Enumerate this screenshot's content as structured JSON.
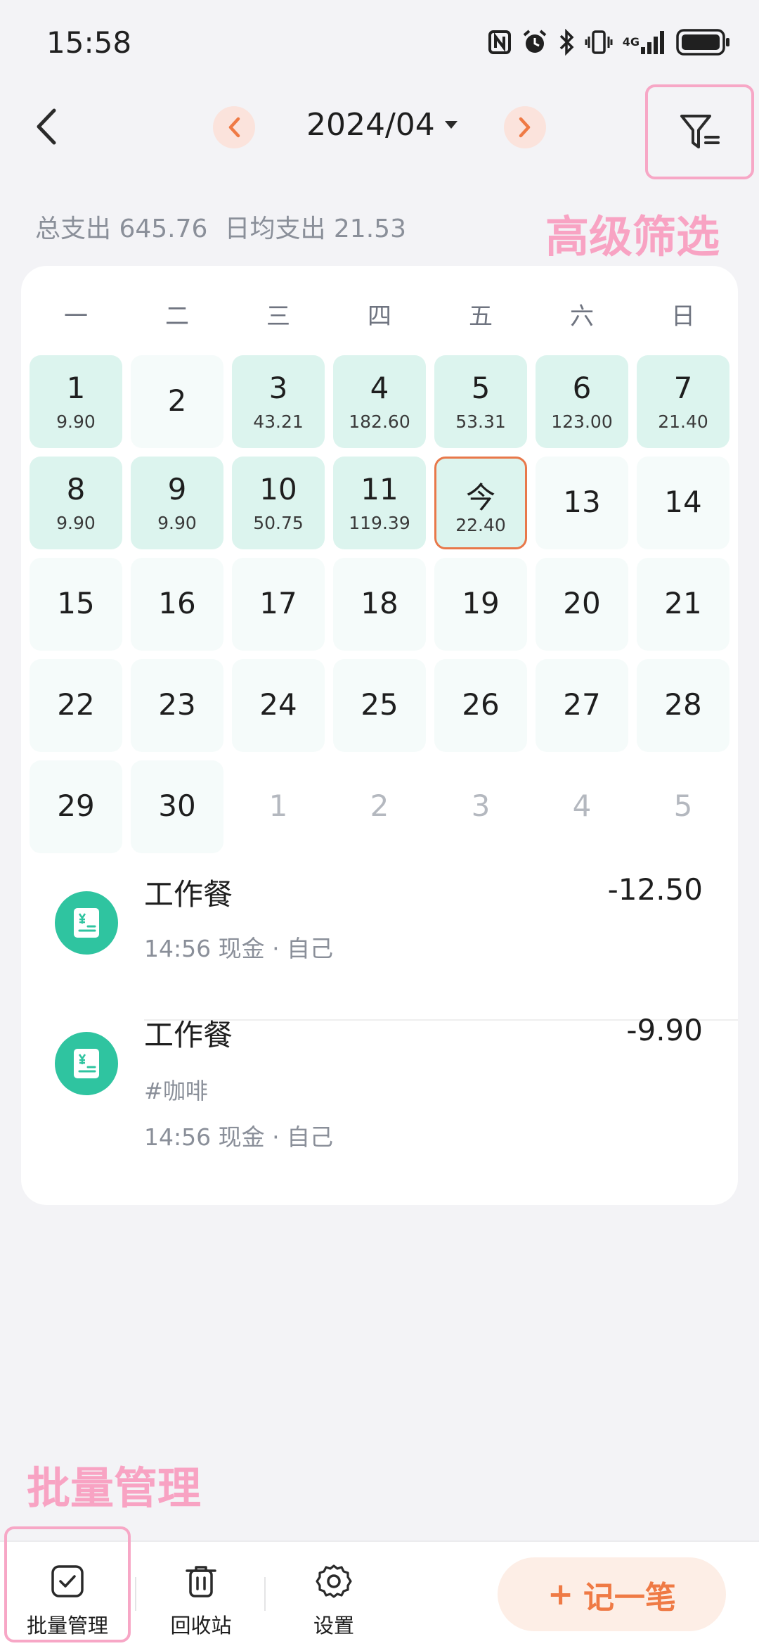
{
  "status_bar": {
    "time": "15:58",
    "network": "4G",
    "icons": [
      "nfc-icon",
      "alarm-icon",
      "bluetooth-icon",
      "vibrate-icon",
      "signal-icon",
      "battery-icon"
    ]
  },
  "header": {
    "month": "2024/04",
    "icons": [
      "back-icon",
      "prev-month-icon",
      "next-month-icon",
      "filter-icon"
    ]
  },
  "summary": {
    "total_label": "总支出",
    "total_value": "645.76",
    "avg_label": "日均支出",
    "avg_value": "21.53"
  },
  "annotations": {
    "filter": "高级筛选",
    "batch": "批量管理"
  },
  "calendar": {
    "weekdays": [
      "一",
      "二",
      "三",
      "四",
      "五",
      "六",
      "日"
    ],
    "days": [
      {
        "label": "1",
        "amount": "9.90",
        "state": "spent"
      },
      {
        "label": "2",
        "amount": "",
        "state": "empty"
      },
      {
        "label": "3",
        "amount": "43.21",
        "state": "spent"
      },
      {
        "label": "4",
        "amount": "182.60",
        "state": "spent"
      },
      {
        "label": "5",
        "amount": "53.31",
        "state": "spent"
      },
      {
        "label": "6",
        "amount": "123.00",
        "state": "spent"
      },
      {
        "label": "7",
        "amount": "21.40",
        "state": "spent"
      },
      {
        "label": "8",
        "amount": "9.90",
        "state": "spent"
      },
      {
        "label": "9",
        "amount": "9.90",
        "state": "spent"
      },
      {
        "label": "10",
        "amount": "50.75",
        "state": "spent"
      },
      {
        "label": "11",
        "amount": "119.39",
        "state": "spent"
      },
      {
        "label": "今",
        "amount": "22.40",
        "state": "today"
      },
      {
        "label": "13",
        "amount": "",
        "state": "empty"
      },
      {
        "label": "14",
        "amount": "",
        "state": "empty"
      },
      {
        "label": "15",
        "amount": "",
        "state": "empty"
      },
      {
        "label": "16",
        "amount": "",
        "state": "empty"
      },
      {
        "label": "17",
        "amount": "",
        "state": "empty"
      },
      {
        "label": "18",
        "amount": "",
        "state": "empty"
      },
      {
        "label": "19",
        "amount": "",
        "state": "empty"
      },
      {
        "label": "20",
        "amount": "",
        "state": "empty"
      },
      {
        "label": "21",
        "amount": "",
        "state": "empty"
      },
      {
        "label": "22",
        "amount": "",
        "state": "empty"
      },
      {
        "label": "23",
        "amount": "",
        "state": "empty"
      },
      {
        "label": "24",
        "amount": "",
        "state": "empty"
      },
      {
        "label": "25",
        "amount": "",
        "state": "empty"
      },
      {
        "label": "26",
        "amount": "",
        "state": "empty"
      },
      {
        "label": "27",
        "amount": "",
        "state": "empty"
      },
      {
        "label": "28",
        "amount": "",
        "state": "empty"
      },
      {
        "label": "29",
        "amount": "",
        "state": "empty"
      },
      {
        "label": "30",
        "amount": "",
        "state": "empty"
      },
      {
        "label": "1",
        "amount": "",
        "state": "other"
      },
      {
        "label": "2",
        "amount": "",
        "state": "other"
      },
      {
        "label": "3",
        "amount": "",
        "state": "other"
      },
      {
        "label": "4",
        "amount": "",
        "state": "other"
      },
      {
        "label": "5",
        "amount": "",
        "state": "other"
      }
    ]
  },
  "transactions": [
    {
      "title": "工作餐",
      "amount": "-12.50",
      "tag": "",
      "meta": "14:56 现金 · 自己",
      "icon": "receipt-icon"
    },
    {
      "title": "工作餐",
      "amount": "-9.90",
      "tag": "#咖啡",
      "meta": "14:56 现金 · 自己",
      "icon": "receipt-icon"
    }
  ],
  "bottom_bar": {
    "batch_label": "批量管理",
    "recycle_label": "回收站",
    "settings_label": "设置",
    "record_label": "记一笔",
    "record_symbol": "+"
  },
  "colors": {
    "accent": "#ef7a45",
    "spent_day": "#dcf4ee",
    "icon_green": "#2fc4a0",
    "annotation_pink": "#f8a3c3"
  }
}
